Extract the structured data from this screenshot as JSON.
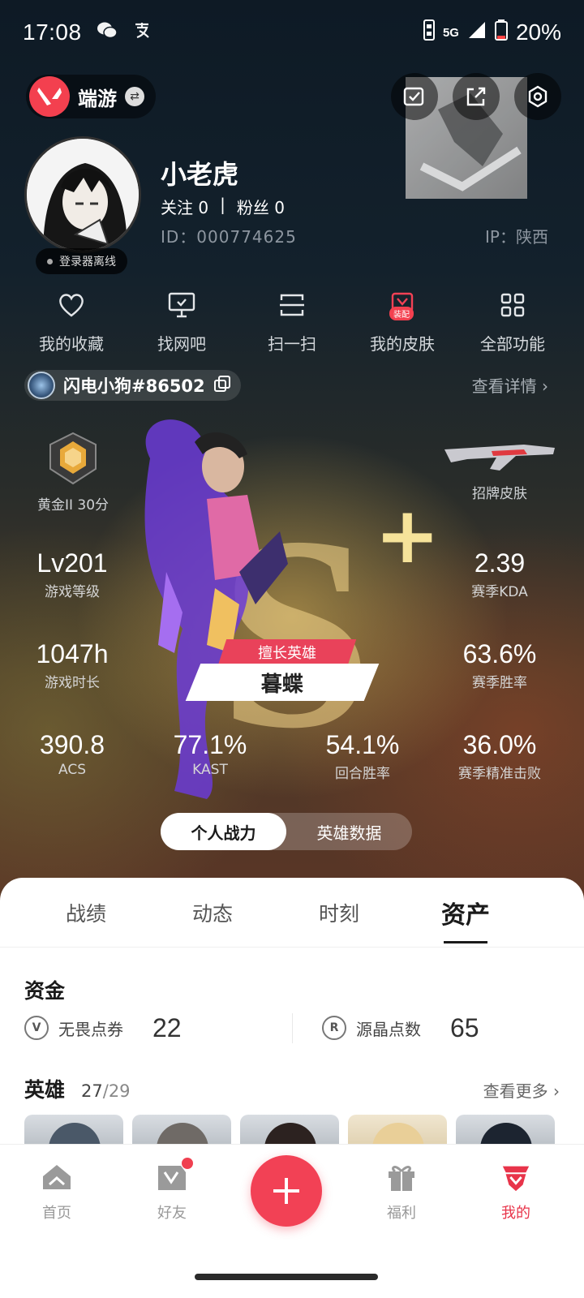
{
  "status_bar": {
    "time": "17:08",
    "network": "5G",
    "battery": "20%"
  },
  "top_bar": {
    "game_logo": "V",
    "game_name": "端游"
  },
  "profile": {
    "username": "小老虎",
    "follow_label": "关注",
    "follow_count": "0",
    "separator": "|",
    "fans_label": "粉丝",
    "fans_count": "0",
    "id_text": "ID：000774625",
    "ip_text": "IP：陕西",
    "login_status": "登录器离线"
  },
  "quick_actions": [
    {
      "label": "我的收藏",
      "icon": "heart-icon"
    },
    {
      "label": "找网吧",
      "icon": "monitor-icon"
    },
    {
      "label": "扫一扫",
      "icon": "scan-icon"
    },
    {
      "label": "我的皮肤",
      "icon": "skin-icon",
      "badge": "装配"
    },
    {
      "label": "全部功能",
      "icon": "grid-icon"
    }
  ],
  "riot": {
    "name": "闪电小狗#86502",
    "view_detail": "查看详情 ›"
  },
  "stats": {
    "rank_label": "黄金II 30分",
    "skin_label": "招牌皮肤",
    "grade": "S",
    "grade_plus": "+",
    "favorite_hero_tag": "擅长英雄",
    "favorite_hero_name": "暮蝶",
    "items": {
      "level": {
        "value": "Lv201",
        "label": "游戏等级"
      },
      "kda": {
        "value": "2.39",
        "label": "赛季KDA"
      },
      "playtime": {
        "value": "1047h",
        "label": "游戏时长"
      },
      "winrate": {
        "value": "63.6%",
        "label": "赛季胜率"
      },
      "acs": {
        "value": "390.8",
        "label": "ACS"
      },
      "kast": {
        "value": "77.1%",
        "label": "KAST"
      },
      "round_winrate": {
        "value": "54.1%",
        "label": "回合胜率"
      },
      "headshot": {
        "value": "36.0%",
        "label": "赛季精准击败"
      }
    }
  },
  "mode_toggle": {
    "personal": "个人战力",
    "hero": "英雄数据"
  },
  "tabs": [
    "战绩",
    "动态",
    "时刻",
    "资产"
  ],
  "assets": {
    "funds_title": "资金",
    "vp_label": "无畏点券",
    "vp_value": "22",
    "rp_label": "源晶点数",
    "rp_value": "65",
    "heroes_title": "英雄",
    "heroes_owned": "27",
    "heroes_total": "/29",
    "see_more": "查看更多 ›"
  },
  "bottom_nav": [
    {
      "label": "首页",
      "icon": "home-icon"
    },
    {
      "label": "好友",
      "icon": "friends-icon"
    },
    {
      "label": "福利",
      "icon": "gift-icon"
    },
    {
      "label": "我的",
      "icon": "profile-icon"
    }
  ],
  "colors": {
    "accent": "#f24155",
    "sheet": "#ffffff"
  }
}
